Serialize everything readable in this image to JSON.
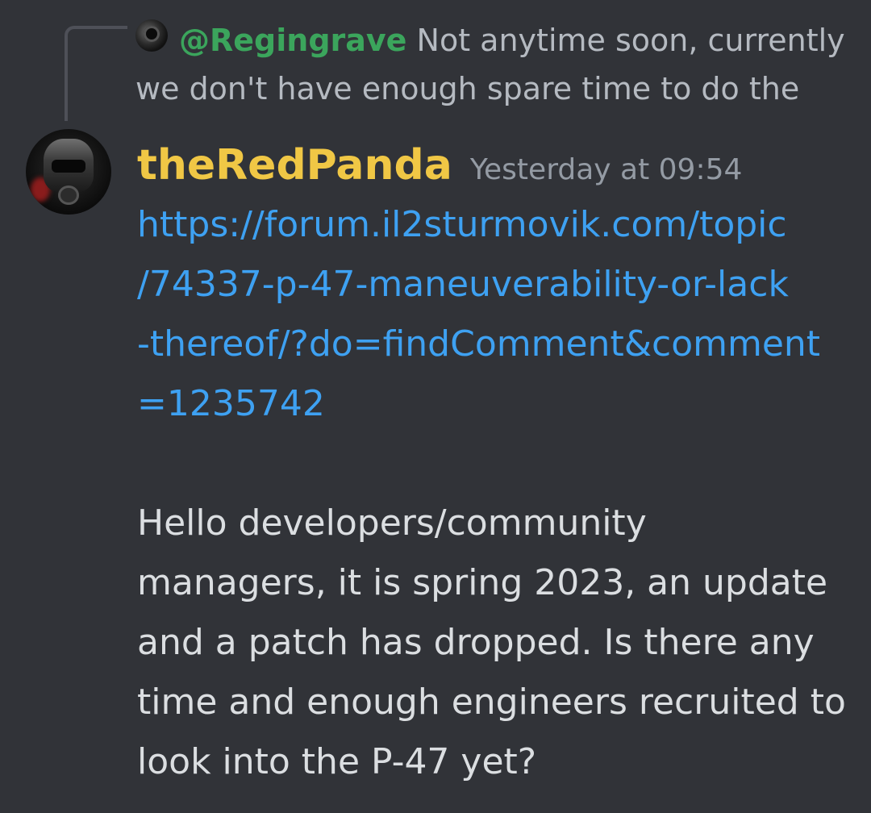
{
  "reply": {
    "mention": "@Regingrave",
    "line1": " Not anytime soon, currently",
    "line2": "we don't have enough spare time to do the"
  },
  "message": {
    "username": "theRedPanda",
    "timestamp": "Yesterday at 09:54",
    "link_text": "https://forum.il2sturmovik.com/topic\n/74337-p-47-maneuverability-or-lack\n-thereof/?do=findComment&comment\n=1235742",
    "body": "Hello developers/community\nmanagers, it is spring 2023, an update\nand a patch has dropped. Is there any\ntime and enough engineers recruited to\nlook into the P-47 yet?"
  },
  "colors": {
    "background": "#313338",
    "username": "#f0c745",
    "mention": "#3ba55c",
    "link": "#3ea1f2",
    "text": "#dbdee1",
    "muted": "#949ba4"
  }
}
